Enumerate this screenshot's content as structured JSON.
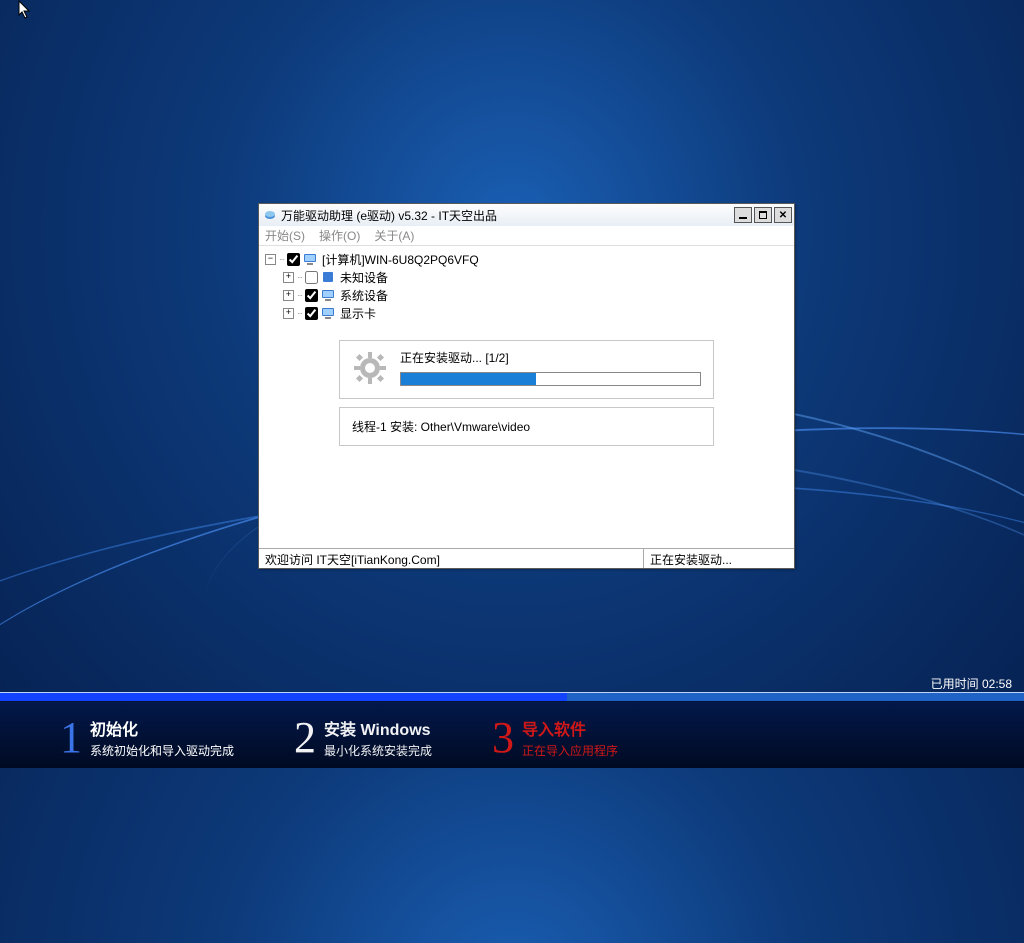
{
  "window": {
    "title": "万能驱动助理 (e驱动) v5.32 - IT天空出品"
  },
  "menu": {
    "start": "开始(S)",
    "operate": "操作(O)",
    "about": "关于(A)"
  },
  "tree": {
    "root": "[计算机]WIN-6U8Q2PQ6VFQ",
    "items": [
      {
        "label": "未知设备",
        "checked": false
      },
      {
        "label": "系统设备",
        "checked": true
      },
      {
        "label": "显示卡",
        "checked": true
      }
    ]
  },
  "progress": {
    "label": "正在安装驱动... [1/2]",
    "percent": 45
  },
  "thread": {
    "text": "线程-1 安装:  Other\\Vmware\\video"
  },
  "status": {
    "left": "欢迎访问 IT天空[iTianKong.Com]",
    "right": "正在安装驱动..."
  },
  "elapsed": {
    "label": "已用时间",
    "value": "02:58"
  },
  "steps": [
    {
      "num": "1",
      "title": "初始化",
      "sub": "系统初始化和导入驱动完成",
      "state": "done"
    },
    {
      "num": "2",
      "title": "安装 Windows",
      "sub": "最小化系统安装完成",
      "state": "done"
    },
    {
      "num": "3",
      "title": "导入软件",
      "sub": "正在导入应用程序",
      "state": "active"
    }
  ]
}
